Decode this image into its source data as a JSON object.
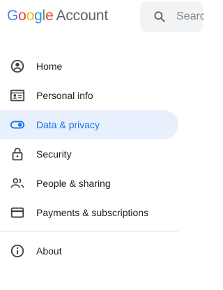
{
  "header": {
    "logo_letters": [
      {
        "char": "G",
        "color": "#4285F4"
      },
      {
        "char": "o",
        "color": "#EA4335"
      },
      {
        "char": "o",
        "color": "#FBBC05"
      },
      {
        "char": "g",
        "color": "#4285F4"
      },
      {
        "char": "l",
        "color": "#34A853"
      },
      {
        "char": "e",
        "color": "#EA4335"
      }
    ],
    "logo_suffix": "Account",
    "search_placeholder": "Search Google Account"
  },
  "nav": {
    "active_color": "#1a73e8",
    "active_background": "#e8f0fe",
    "items": [
      {
        "label": "Home",
        "icon": "account-circle-icon",
        "active": false
      },
      {
        "label": "Personal info",
        "icon": "id-card-icon",
        "active": false
      },
      {
        "label": "Data & privacy",
        "icon": "toggle-icon",
        "active": true
      },
      {
        "label": "Security",
        "icon": "lock-icon",
        "active": false
      },
      {
        "label": "People & sharing",
        "icon": "people-icon",
        "active": false
      },
      {
        "label": "Payments & subscriptions",
        "icon": "credit-card-icon",
        "active": false
      }
    ],
    "about": {
      "label": "About",
      "icon": "info-icon"
    }
  }
}
